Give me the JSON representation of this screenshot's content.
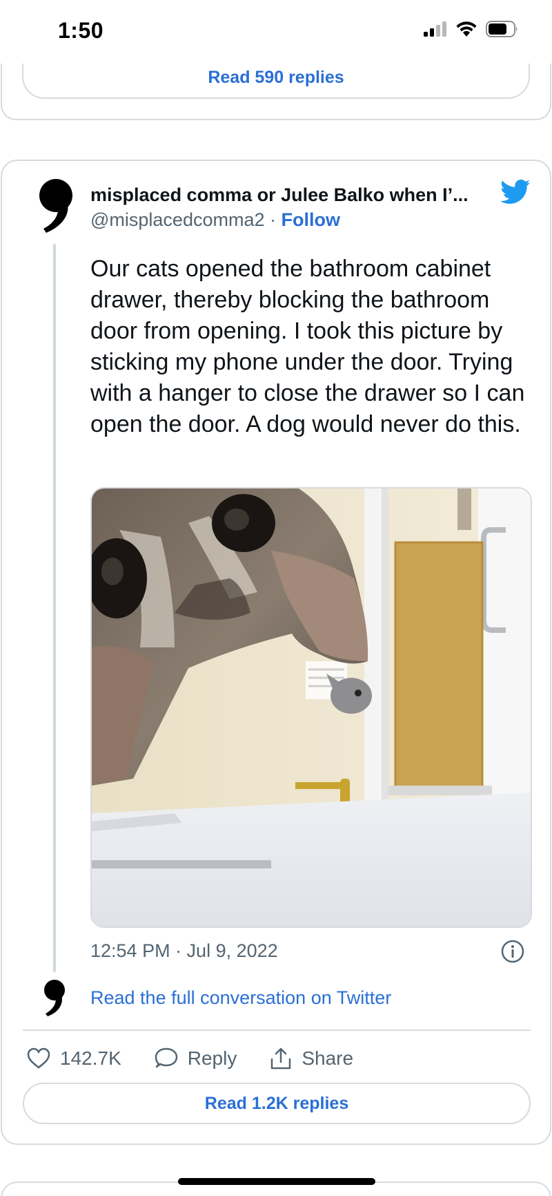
{
  "status_bar": {
    "time": "1:50"
  },
  "previous_tweet": {
    "read_replies_label": "Read 590 replies"
  },
  "tweet": {
    "author_name": "misplaced comma or Julee Balko when I’...",
    "handle": "@misplacedcomma2",
    "separator": " · ",
    "follow_label": "Follow",
    "text": "Our cats opened the bathroom cabinet drawer, thereby blocking the bathroom door from opening. I took this picture by sticking my phone under the door. Trying with a hanger to close the drawer so I can open the door. A dog would never do this.",
    "timestamp": "12:54 PM · Jul 9, 2022",
    "read_full_conversation": "Read the full conversation on Twitter",
    "like_count": "142.7K",
    "reply_label": "Reply",
    "share_label": "Share",
    "read_replies_label": "Read 1.2K replies"
  },
  "colors": {
    "accent_blue": "#2a6fd6",
    "twitter_blue": "#1d9bf0",
    "muted_text": "#536471",
    "border": "#d6dbe0"
  },
  "icons": [
    "signal-icon",
    "wifi-icon",
    "battery-icon",
    "twitter-bird-icon",
    "info-icon",
    "heart-icon",
    "reply-bubble-icon",
    "share-icon"
  ]
}
